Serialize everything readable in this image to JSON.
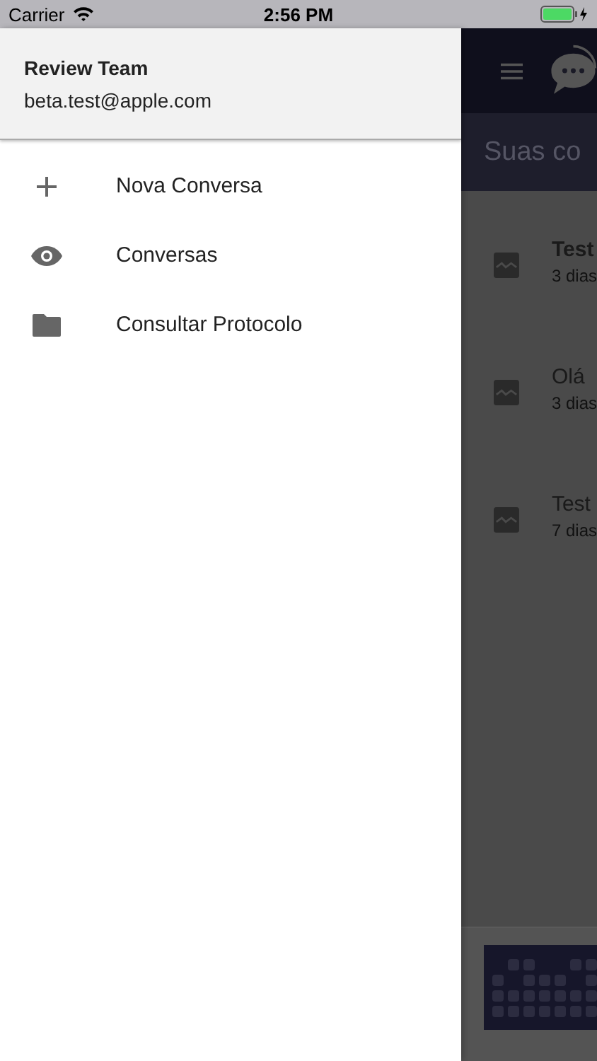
{
  "status_bar": {
    "carrier": "Carrier",
    "time": "2:56 PM"
  },
  "drawer": {
    "user_name": "Review Team",
    "user_email": "beta.test@apple.com",
    "items": [
      {
        "kind": "add",
        "label": "Nova Conversa"
      },
      {
        "kind": "view",
        "label": "Conversas"
      },
      {
        "kind": "browse",
        "label": "Consultar Protocolo"
      }
    ]
  },
  "background_app": {
    "title": "Suas co",
    "conversations": [
      {
        "title": "Test",
        "time": "3 dias",
        "unread": true
      },
      {
        "title": "Olá",
        "time": "3 dias",
        "unread": false
      },
      {
        "title": "Test",
        "time": "7 dias",
        "unread": false
      }
    ]
  }
}
